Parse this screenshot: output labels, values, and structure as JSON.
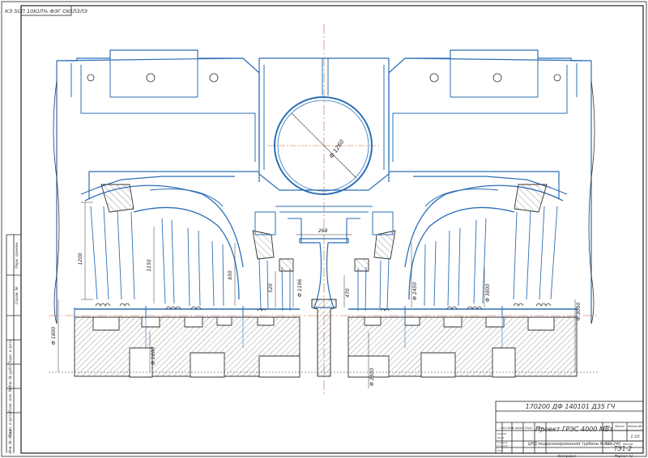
{
  "corner_stamp": "КЭ 5СП 10ЮЛ% ФЭГ ОЮЛЗЛЭ",
  "dimensions": {
    "d_pipe": "Ф 1260",
    "w_top": "268",
    "h_left_outer": "1200",
    "h_left_mid": "1150",
    "h_left_inner": "850",
    "h_left_core": "520",
    "d_left_small": "Ф 1196",
    "h_right_core": "470",
    "d_right_a": "Ф 2450",
    "d_right_b": "Ф 3800",
    "d_right_outer": "Ф 3000",
    "d_left_low": "Ф 1800",
    "d_left_base": "Ф 1600",
    "d_center_base": "Ф 2300"
  },
  "title_block": {
    "doc_code": "170200 ДФ 140101 Д35 ГЧ",
    "project": "Проект ГРЭС 4000 МВт",
    "drawing": "ЦНД модернизированной турбины К-800-240",
    "sheet_code": "ТЭ1-2",
    "scale": "1:10",
    "col_lit": "Лит",
    "col_mass": "Масса",
    "col_scale": "Масштаб",
    "sheet_label": "Лист",
    "sheets_label": "Листов",
    "rev_headers": [
      "Изм Лист",
      "№ докум.",
      "Подп.",
      "Дата"
    ],
    "roles": [
      "Разраб.",
      "Пров.",
      "Т.контр.",
      "Н.контр.",
      "Утв."
    ],
    "footer_left": "Копировал",
    "footer_right": "Формат А1"
  },
  "side_strip": [
    "Перв. примен.",
    "Справ. №",
    "Подп. и дата",
    "Инв. № дубл.",
    "Взам. инв. №",
    "Подп. и дата",
    "Инв. № подл."
  ]
}
